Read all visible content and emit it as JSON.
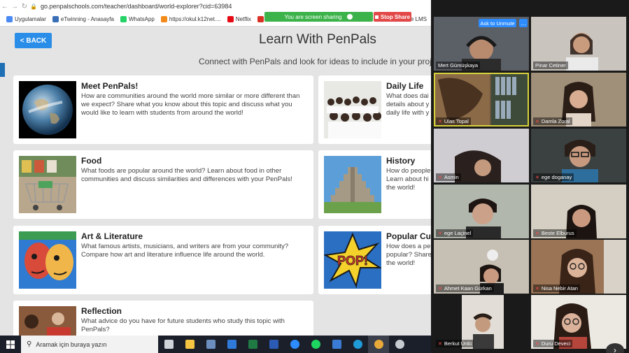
{
  "browser": {
    "url": "go.penpalschools.com/teacher/dashboard/world-explorer?cid=63984",
    "bookmarks": [
      {
        "label": "Uygulamalar",
        "color": "#4a8af4"
      },
      {
        "label": "eTwinning - Anasayfa",
        "color": "#3a6fb7"
      },
      {
        "label": "WhatsApp",
        "color": "#25d366"
      },
      {
        "label": "https://okul.k12net....",
        "color": "#f28a1a"
      },
      {
        "label": "Netflix",
        "color": "#e50914"
      },
      {
        "label": "Ya",
        "color": "#d93025"
      },
      {
        "label": "e LMS",
        "color": "#7b7b7b"
      }
    ]
  },
  "zoom_share": {
    "banner_text": "You are screen sharing",
    "stop_label": "Stop Share",
    "ask_unmute": "Ask to Unmute",
    "more": "…"
  },
  "page": {
    "back_label": "< BACK",
    "title": "Learn With PenPals",
    "subtitle": "Connect with PenPals and look for ideas to include in your project"
  },
  "cards": [
    {
      "title": "Meet PenPals!",
      "desc": "How are communities around the world more similar or more different than we expect? Share what you know about this topic and discuss what you would like to learn with students from around the world!"
    },
    {
      "title": "Daily Life",
      "desc": "What does dai details about y daily life with y"
    },
    {
      "title": "Food",
      "desc": "What foods are popular around the world? Learn about food in other communities and discuss similarities and differences with your PenPals!"
    },
    {
      "title": "History",
      "desc": "How do people Learn about hi the world!"
    },
    {
      "title": "Art & Literature",
      "desc": "What famous artists, musicians, and writers are from your community? Compare how art and literature influence life around the world."
    },
    {
      "title": "Popular Cul",
      "desc": "How does a pe popular? Share the world!"
    },
    {
      "title": "Reflection",
      "desc": "What advice do you have for future students who study this topic with PenPals?"
    }
  ],
  "pop_text": "POP!",
  "taskbar": {
    "search_placeholder": "Aramak için buraya yazın",
    "icons": [
      {
        "name": "task-view-icon",
        "color": "#cfd3da"
      },
      {
        "name": "file-explorer-icon",
        "color": "#f5c542"
      },
      {
        "name": "store-icon",
        "color": "#6c8ebf"
      },
      {
        "name": "mail-icon",
        "color": "#2f7ad8"
      },
      {
        "name": "excel-icon",
        "color": "#1f7a44"
      },
      {
        "name": "word-icon",
        "color": "#2b5bb5"
      },
      {
        "name": "zoom-icon",
        "color": "#2d8cff"
      },
      {
        "name": "spotify-icon",
        "color": "#1ed760"
      },
      {
        "name": "photos-icon",
        "color": "#3a7bd5"
      },
      {
        "name": "edge-icon",
        "color": "#1f9bd8"
      },
      {
        "name": "chrome-icon",
        "color": "#e8a93a"
      },
      {
        "name": "app-icon",
        "color": "#c7cbd1"
      }
    ]
  },
  "participants": [
    {
      "name": "Mert Gümüşkaya",
      "muted": false,
      "bg": "#5b5f66"
    },
    {
      "name": "Pinar Cetiner",
      "muted": false,
      "bg": "#c9c4bd"
    },
    {
      "name": "Ulas Topal",
      "muted": true,
      "bg": "#6a553f"
    },
    {
      "name": "Damla Zoral",
      "muted": true,
      "bg": "#8a7a66"
    },
    {
      "name": "Asmin",
      "muted": true,
      "bg": "#b6b4ba"
    },
    {
      "name": "ege doganay",
      "muted": true,
      "bg": "#3b4140"
    },
    {
      "name": "ege Laçinel",
      "muted": true,
      "bg": "#9fa29a"
    },
    {
      "name": "Beste Elburus",
      "muted": true,
      "bg": "#c4bfb2"
    },
    {
      "name": "Ahmet Kaan Gürkan",
      "muted": true,
      "bg": "#b9b2a7"
    },
    {
      "name": "Nisa Nebir Atan",
      "muted": true,
      "bg": "#77543c"
    },
    {
      "name": "Berkut Ünlü",
      "muted": true,
      "bg": "#d8d3cc"
    },
    {
      "name": "Duru Deveci",
      "muted": true,
      "bg": "#e2ddd6"
    }
  ]
}
